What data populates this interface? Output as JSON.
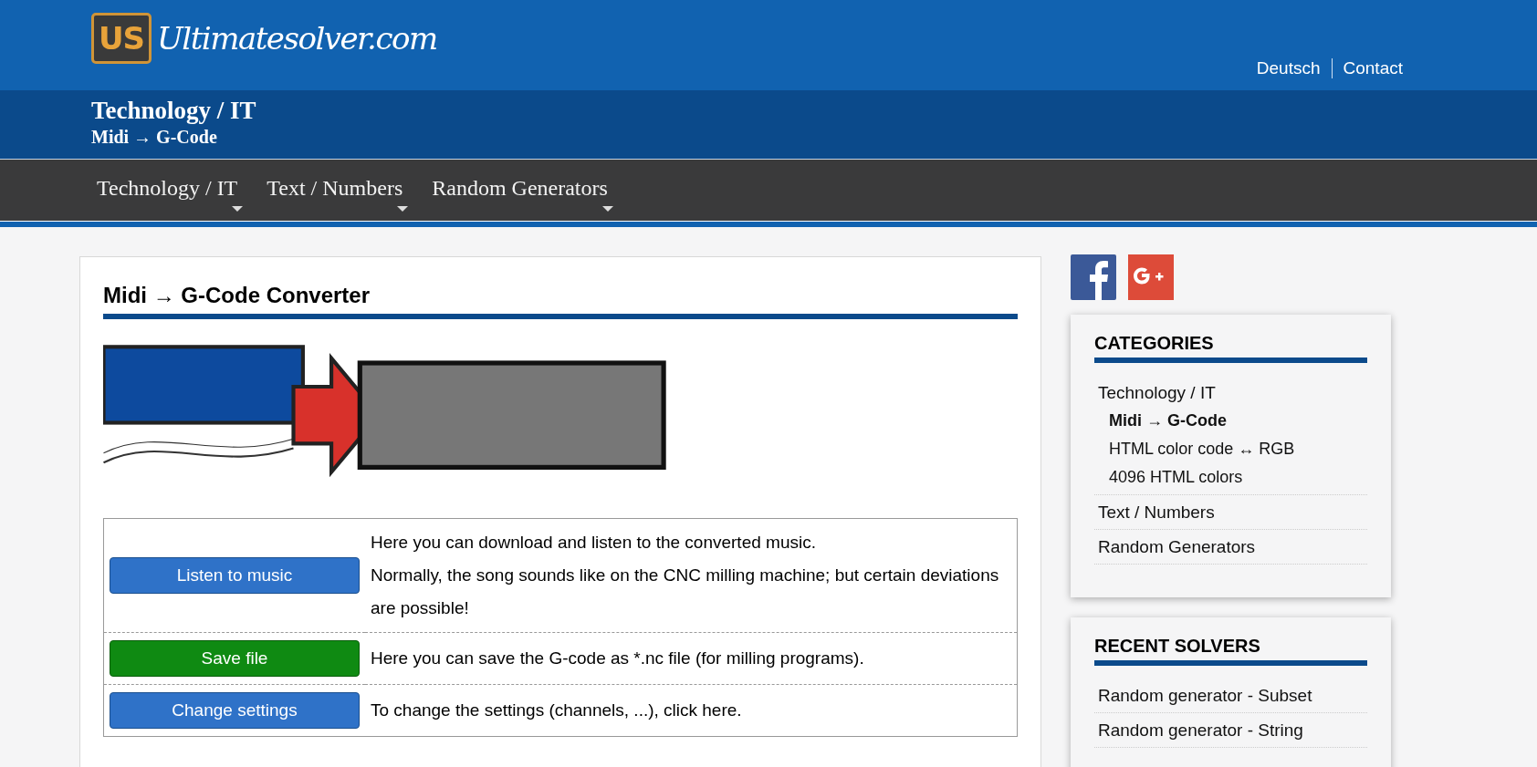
{
  "logo": {
    "badge": "US",
    "name": "Ultimatesolver.com"
  },
  "top_links": [
    "Deutsch",
    "Contact"
  ],
  "breadcrumb": {
    "category": "Technology / IT",
    "page": "Midi → G-Code"
  },
  "nav": [
    {
      "label": "Technology / IT"
    },
    {
      "label": "Text / Numbers"
    },
    {
      "label": "Random Generators"
    }
  ],
  "main": {
    "title": "Midi → G-Code Converter",
    "actions": [
      {
        "button": "Listen to music",
        "kind": "primary",
        "description": [
          "Here you can download and listen to the converted music.",
          "Normally, the song sounds like on the CNC milling machine; but certain deviations are possible!"
        ]
      },
      {
        "button": "Save file",
        "kind": "success",
        "description": [
          "Here you can save the G-code as *.nc file (for milling programs)."
        ]
      },
      {
        "button": "Change settings",
        "kind": "primary",
        "description": [
          "To change the settings (channels, ...), click here."
        ]
      }
    ]
  },
  "categories": {
    "title": "CATEGORIES",
    "items": [
      {
        "label": "Technology / IT",
        "selected": false,
        "children": [
          {
            "label": "Midi → G-Code",
            "selected": true
          },
          {
            "label": "HTML color code ↔ RGB",
            "selected": false
          },
          {
            "label": "4096 HTML colors",
            "selected": false
          }
        ]
      },
      {
        "label": "Text / Numbers",
        "selected": false
      },
      {
        "label": "Random Generators",
        "selected": false
      }
    ]
  },
  "recent_solvers": {
    "title": "RECENT SOLVERS",
    "items": [
      "Random generator - Subset",
      "Random generator - String"
    ]
  }
}
